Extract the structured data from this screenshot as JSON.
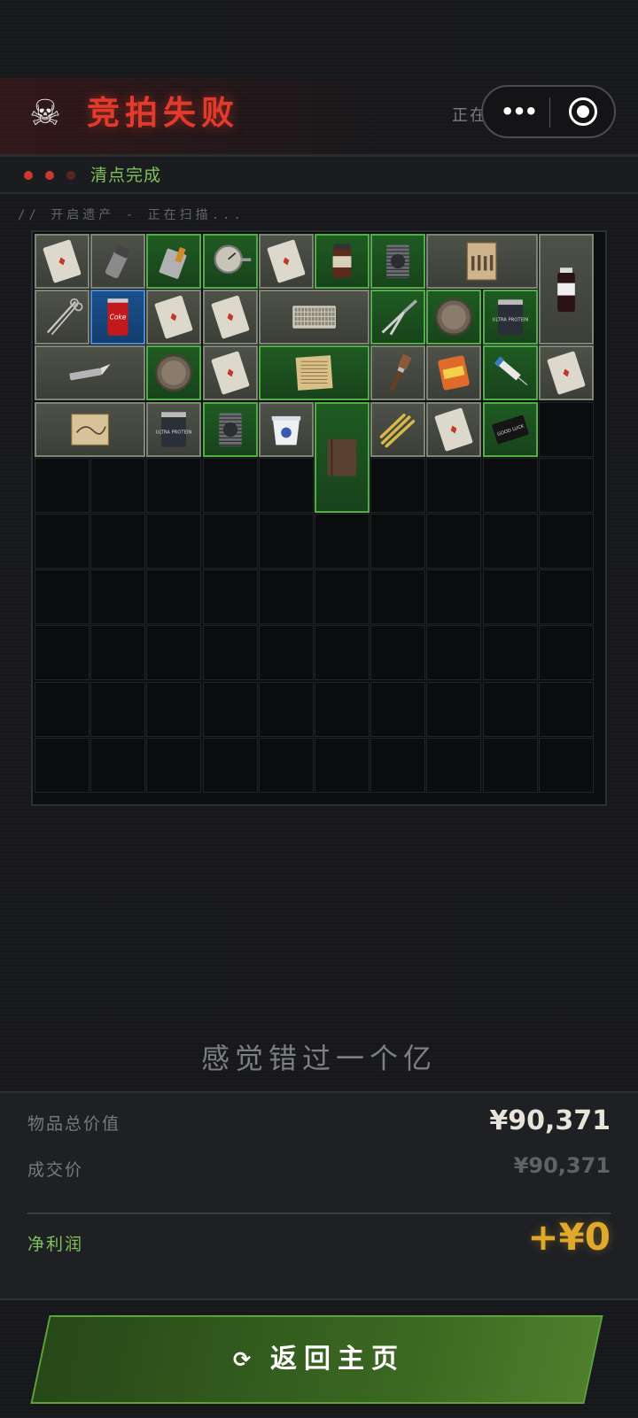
{
  "header": {
    "title": "竞拍失败",
    "skull_icon": "skull-icon",
    "restore_text": "正在还原遗产情报...",
    "title_color": "#e33b2b"
  },
  "mini_program_capsule": {
    "menu_icon": "more-dots-icon",
    "close_icon": "target-close-icon"
  },
  "status": {
    "text": "清点完成",
    "dot_colors": [
      "#c9392c",
      "#c9392c",
      "#5a2320"
    ],
    "text_color": "#7fc15a"
  },
  "scan_line": "//  开启遗产 - 正在扫描...",
  "inventory": {
    "columns": 10,
    "rows": 10,
    "items": [
      {
        "name": "playing-card",
        "rarity": "gray",
        "col": 0,
        "row": 0,
        "w": 1,
        "h": 1,
        "icon": "card-icon"
      },
      {
        "name": "grinder",
        "rarity": "gray",
        "col": 1,
        "row": 0,
        "w": 1,
        "h": 1,
        "icon": "grinder-icon"
      },
      {
        "name": "lighter",
        "rarity": "green",
        "col": 2,
        "row": 0,
        "w": 1,
        "h": 1,
        "icon": "lighter-icon"
      },
      {
        "name": "pressure-gauge",
        "rarity": "green",
        "col": 3,
        "row": 0,
        "w": 1,
        "h": 1,
        "icon": "gauge-icon"
      },
      {
        "name": "playing-card",
        "rarity": "gray",
        "col": 4,
        "row": 0,
        "w": 1,
        "h": 1,
        "icon": "card-icon"
      },
      {
        "name": "coffee-jar",
        "rarity": "green",
        "col": 5,
        "row": 0,
        "w": 1,
        "h": 1,
        "icon": "jar-icon"
      },
      {
        "name": "cpu-cooler",
        "rarity": "green",
        "col": 6,
        "row": 0,
        "w": 1,
        "h": 1,
        "icon": "cooler-icon"
      },
      {
        "name": "old-photo",
        "rarity": "gray",
        "col": 7,
        "row": 0,
        "w": 2,
        "h": 1,
        "icon": "photo-icon"
      },
      {
        "name": "medicine-bottle",
        "rarity": "gray",
        "col": 9,
        "row": 0,
        "w": 1,
        "h": 2,
        "icon": "bottle-icon"
      },
      {
        "name": "scissors",
        "rarity": "gray",
        "col": 0,
        "row": 1,
        "w": 1,
        "h": 1,
        "icon": "scissors-icon"
      },
      {
        "name": "cola-can",
        "rarity": "blue",
        "col": 1,
        "row": 1,
        "w": 1,
        "h": 1,
        "icon": "can-icon"
      },
      {
        "name": "playing-card",
        "rarity": "gray",
        "col": 2,
        "row": 1,
        "w": 1,
        "h": 1,
        "icon": "card-icon"
      },
      {
        "name": "playing-card",
        "rarity": "gray",
        "col": 3,
        "row": 1,
        "w": 1,
        "h": 1,
        "icon": "card-icon"
      },
      {
        "name": "keyboard",
        "rarity": "gray",
        "col": 4,
        "row": 1,
        "w": 2,
        "h": 1,
        "icon": "keyboard-icon"
      },
      {
        "name": "pliers",
        "rarity": "green",
        "col": 6,
        "row": 1,
        "w": 1,
        "h": 1,
        "icon": "pliers-icon"
      },
      {
        "name": "coin",
        "rarity": "green",
        "col": 7,
        "row": 1,
        "w": 1,
        "h": 1,
        "icon": "coin-icon"
      },
      {
        "name": "protein-tub",
        "rarity": "green",
        "col": 8,
        "row": 1,
        "w": 1,
        "h": 1,
        "icon": "tub-icon"
      },
      {
        "name": "utility-knife",
        "rarity": "gray",
        "col": 0,
        "row": 2,
        "w": 2,
        "h": 1,
        "icon": "knife-icon"
      },
      {
        "name": "coin",
        "rarity": "green",
        "col": 2,
        "row": 2,
        "w": 1,
        "h": 1,
        "icon": "coin-icon"
      },
      {
        "name": "playing-card",
        "rarity": "gray",
        "col": 3,
        "row": 2,
        "w": 1,
        "h": 1,
        "icon": "card-icon"
      },
      {
        "name": "old-documents",
        "rarity": "green",
        "col": 4,
        "row": 2,
        "w": 2,
        "h": 1,
        "icon": "documents-icon"
      },
      {
        "name": "paint-brush",
        "rarity": "gray",
        "col": 6,
        "row": 2,
        "w": 1,
        "h": 1,
        "icon": "brush-icon"
      },
      {
        "name": "snack-bag",
        "rarity": "gray",
        "col": 7,
        "row": 2,
        "w": 1,
        "h": 1,
        "icon": "snack-icon"
      },
      {
        "name": "syringe",
        "rarity": "green",
        "col": 8,
        "row": 2,
        "w": 1,
        "h": 1,
        "icon": "syringe-icon"
      },
      {
        "name": "playing-card",
        "rarity": "gray",
        "col": 9,
        "row": 2,
        "w": 1,
        "h": 1,
        "icon": "card-icon"
      },
      {
        "name": "treasure-map",
        "rarity": "gray",
        "col": 0,
        "row": 3,
        "w": 2,
        "h": 1,
        "icon": "map-icon"
      },
      {
        "name": "protein-tub",
        "rarity": "gray",
        "col": 2,
        "row": 3,
        "w": 1,
        "h": 1,
        "icon": "tub-icon"
      },
      {
        "name": "cpu-cooler",
        "rarity": "green",
        "col": 3,
        "row": 3,
        "w": 1,
        "h": 1,
        "icon": "cooler-icon"
      },
      {
        "name": "yogurt-cup",
        "rarity": "gray",
        "col": 4,
        "row": 3,
        "w": 1,
        "h": 1,
        "icon": "cup-icon"
      },
      {
        "name": "leather-notebook",
        "rarity": "green",
        "col": 5,
        "row": 3,
        "w": 1,
        "h": 2,
        "icon": "notebook-icon"
      },
      {
        "name": "fries",
        "rarity": "gray",
        "col": 6,
        "row": 3,
        "w": 1,
        "h": 1,
        "icon": "fries-icon"
      },
      {
        "name": "playing-card",
        "rarity": "gray",
        "col": 7,
        "row": 3,
        "w": 1,
        "h": 1,
        "icon": "card-icon"
      },
      {
        "name": "good-luck-card",
        "rarity": "green",
        "col": 8,
        "row": 3,
        "w": 1,
        "h": 1,
        "icon": "luck-card-icon"
      }
    ]
  },
  "tagline": "感觉错过一个亿",
  "summary": {
    "total_label": "物品总价值",
    "total_value": "¥90,371",
    "deal_label": "成交价",
    "deal_value": "¥90,371",
    "profit_label": "净利润",
    "profit_value": "+¥0",
    "profit_color": "#e0a92a"
  },
  "action": {
    "label": "返回主页",
    "icon": "refresh-icon"
  }
}
